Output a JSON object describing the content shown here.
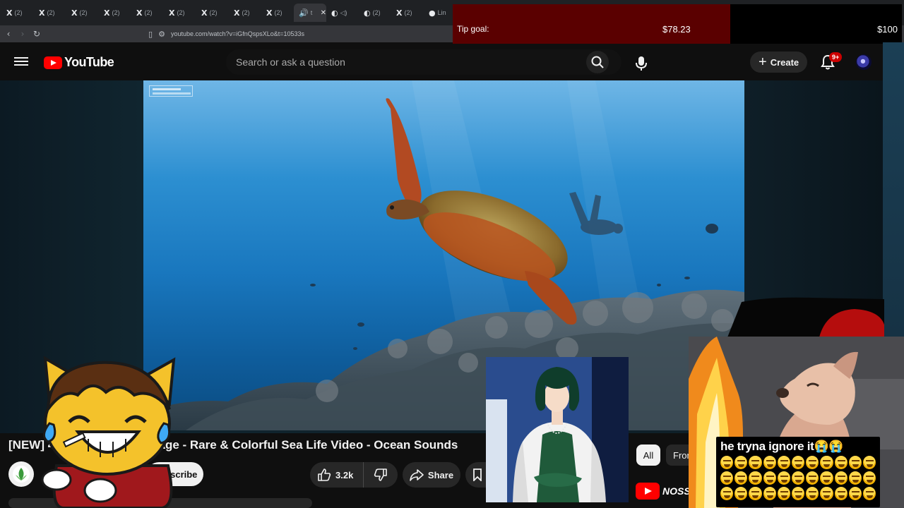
{
  "browser": {
    "tabs": [
      {
        "favicon": "X",
        "title": "(2)"
      },
      {
        "favicon": "X",
        "title": "(2)"
      },
      {
        "favicon": "X",
        "title": "(2)"
      },
      {
        "favicon": "X",
        "title": "(2)"
      },
      {
        "favicon": "X",
        "title": "(2)"
      },
      {
        "favicon": "X",
        "title": "(2)"
      },
      {
        "favicon": "X",
        "title": "(2)"
      },
      {
        "favicon": "X",
        "title": "(2)"
      },
      {
        "favicon": "X",
        "title": "(2)"
      },
      {
        "favicon": "🔊",
        "title": "t",
        "active": true
      },
      {
        "favicon": "◐",
        "title": "◁)"
      },
      {
        "favicon": "◐",
        "title": "(2)"
      },
      {
        "favicon": "X",
        "title": "(2)"
      },
      {
        "favicon": "●",
        "title": "Lin"
      }
    ],
    "url": "youtube.com/watch?v=iGfnQspsXLo&t=10533s"
  },
  "youtube": {
    "logo_text": "YouTube",
    "search_placeholder": "Search or ask a question",
    "create_label": "Create",
    "notification_badge": "9+",
    "video_title": "[NEW] 4K Underwater footage - Rare & Colorful Sea Life Video - Ocean Sounds",
    "subscribe_label": "Subscribe",
    "like_count": "3.2k",
    "share_label": "Share",
    "chips": {
      "all": "All",
      "from": "From"
    },
    "related_channel": "NOSS"
  },
  "tip_goal": {
    "label": "Tip goal:",
    "current": "$78.23",
    "target": "$100",
    "progress": 0.7823
  },
  "overlay": {
    "caption": "he tryna ignore it😭😭",
    "emoji_rows": 3,
    "emoji_per_row": 11
  },
  "colors": {
    "youtube_red": "#ff0000",
    "tip_fill": "#5a0000",
    "badge_red": "#cc0000"
  }
}
